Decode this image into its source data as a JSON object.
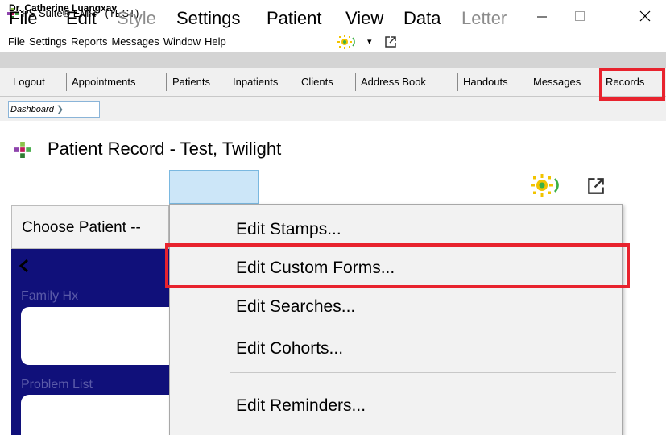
{
  "app": {
    "title": "PS Suite® EMR   (TEST)",
    "window_controls": [
      "minimize",
      "maximize",
      "close"
    ]
  },
  "main_menu": {
    "items": [
      "File",
      "Settings",
      "Reports",
      "Messages",
      "Window",
      "Help"
    ],
    "icons": [
      "sun-icon",
      "dropdown-caret-icon",
      "external-window-icon"
    ],
    "caret": "▾"
  },
  "user": {
    "name": "Dr. Catherine Luangxay"
  },
  "links_bar": {
    "items": [
      "Logout",
      "Appointments",
      "Patients",
      "Inpatients",
      "Clients",
      "Address Book",
      "Handouts",
      "Messages",
      "Records"
    ]
  },
  "breadcrumb": {
    "label": "Dashboard",
    "arrow": "❯"
  },
  "patient_record": {
    "title": "Patient Record - Test, Twilight",
    "menu": {
      "items": [
        {
          "label": "File",
          "enabled": true
        },
        {
          "label": "Edit",
          "enabled": true
        },
        {
          "label": "Style",
          "enabled": false
        },
        {
          "label": "Settings",
          "enabled": true,
          "open": true
        },
        {
          "label": "Patient",
          "enabled": true
        },
        {
          "label": "View",
          "enabled": true
        },
        {
          "label": "Data",
          "enabled": true
        },
        {
          "label": "Letter",
          "enabled": false
        }
      ]
    },
    "choose_patient": "Choose Patient --",
    "sections": [
      "Family Hx",
      "Problem List"
    ]
  },
  "settings_dropdown": {
    "items": [
      "Edit Stamps...",
      "Edit Custom Forms...",
      "Edit Searches...",
      "Edit Cohorts...",
      "Edit Reminders..."
    ],
    "highlighted": "Edit Custom Forms..."
  },
  "colors": {
    "highlight_red": "#e8232e",
    "navy_panel": "#10107a",
    "menu_highlight": "#cce6f8",
    "sun_yellow": "#f2c400",
    "signal_green": "#3cb044"
  }
}
